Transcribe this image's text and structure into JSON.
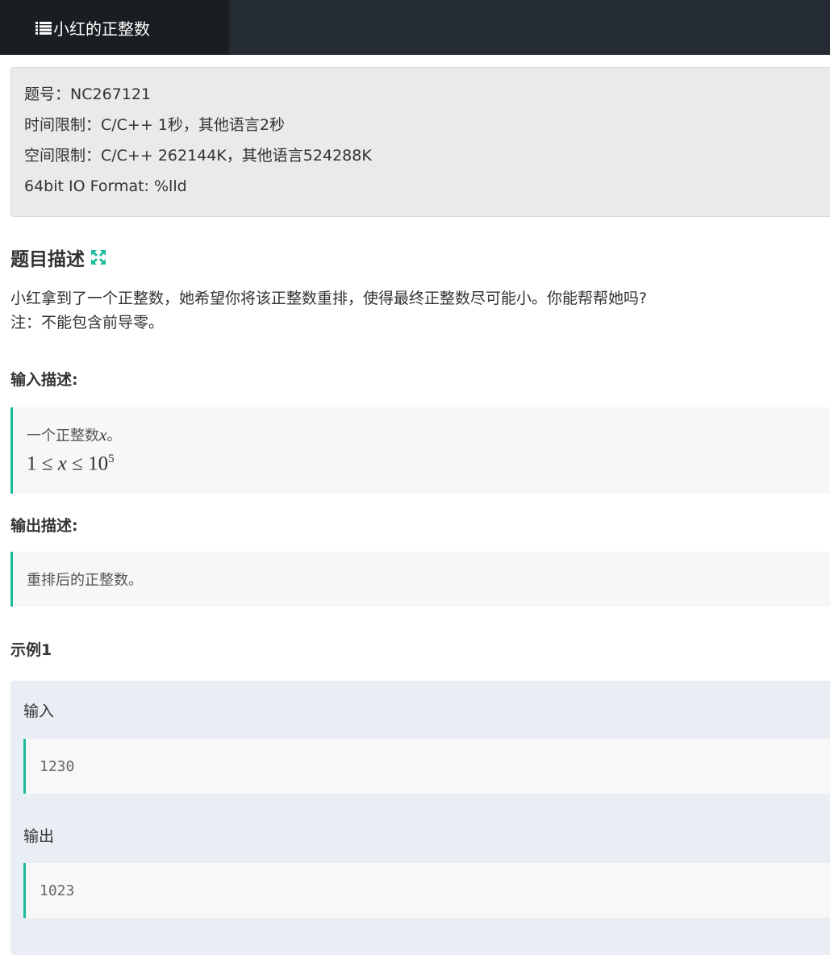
{
  "header": {
    "tab_title": "小红的正整数",
    "tab_icon": "list-icon"
  },
  "info": {
    "problem_id": "题号：NC267121",
    "time_limit": "时间限制：C/C++ 1秒，其他语言2秒",
    "memory_limit": "空间限制：C/C++ 262144K，其他语言524288K",
    "io_format": "64bit IO Format: %lld"
  },
  "description": {
    "heading": "题目描述",
    "line1": "小红拿到了一个正整数，她希望你将该正整数重排，使得最终正整数尽可能小。你能帮帮她吗?",
    "line2": "注：不能包含前导零。"
  },
  "input_desc": {
    "heading": "输入描述:",
    "text_prefix": "一个正整数",
    "text_var": "x",
    "text_suffix": "。",
    "math_lhs": "1",
    "math_op1": "≤",
    "math_var": "x",
    "math_op2": "≤",
    "math_base": "10",
    "math_exp": "5"
  },
  "output_desc": {
    "heading": "输出描述:",
    "text": "重排后的正整数。"
  },
  "example": {
    "heading": "示例1",
    "input_label": "输入",
    "input_value": "1230",
    "output_label": "输出",
    "output_value": "1023"
  },
  "colors": {
    "accent": "#1abc9c",
    "topbar": "#252b32",
    "active_tab": "#1a1e21"
  }
}
